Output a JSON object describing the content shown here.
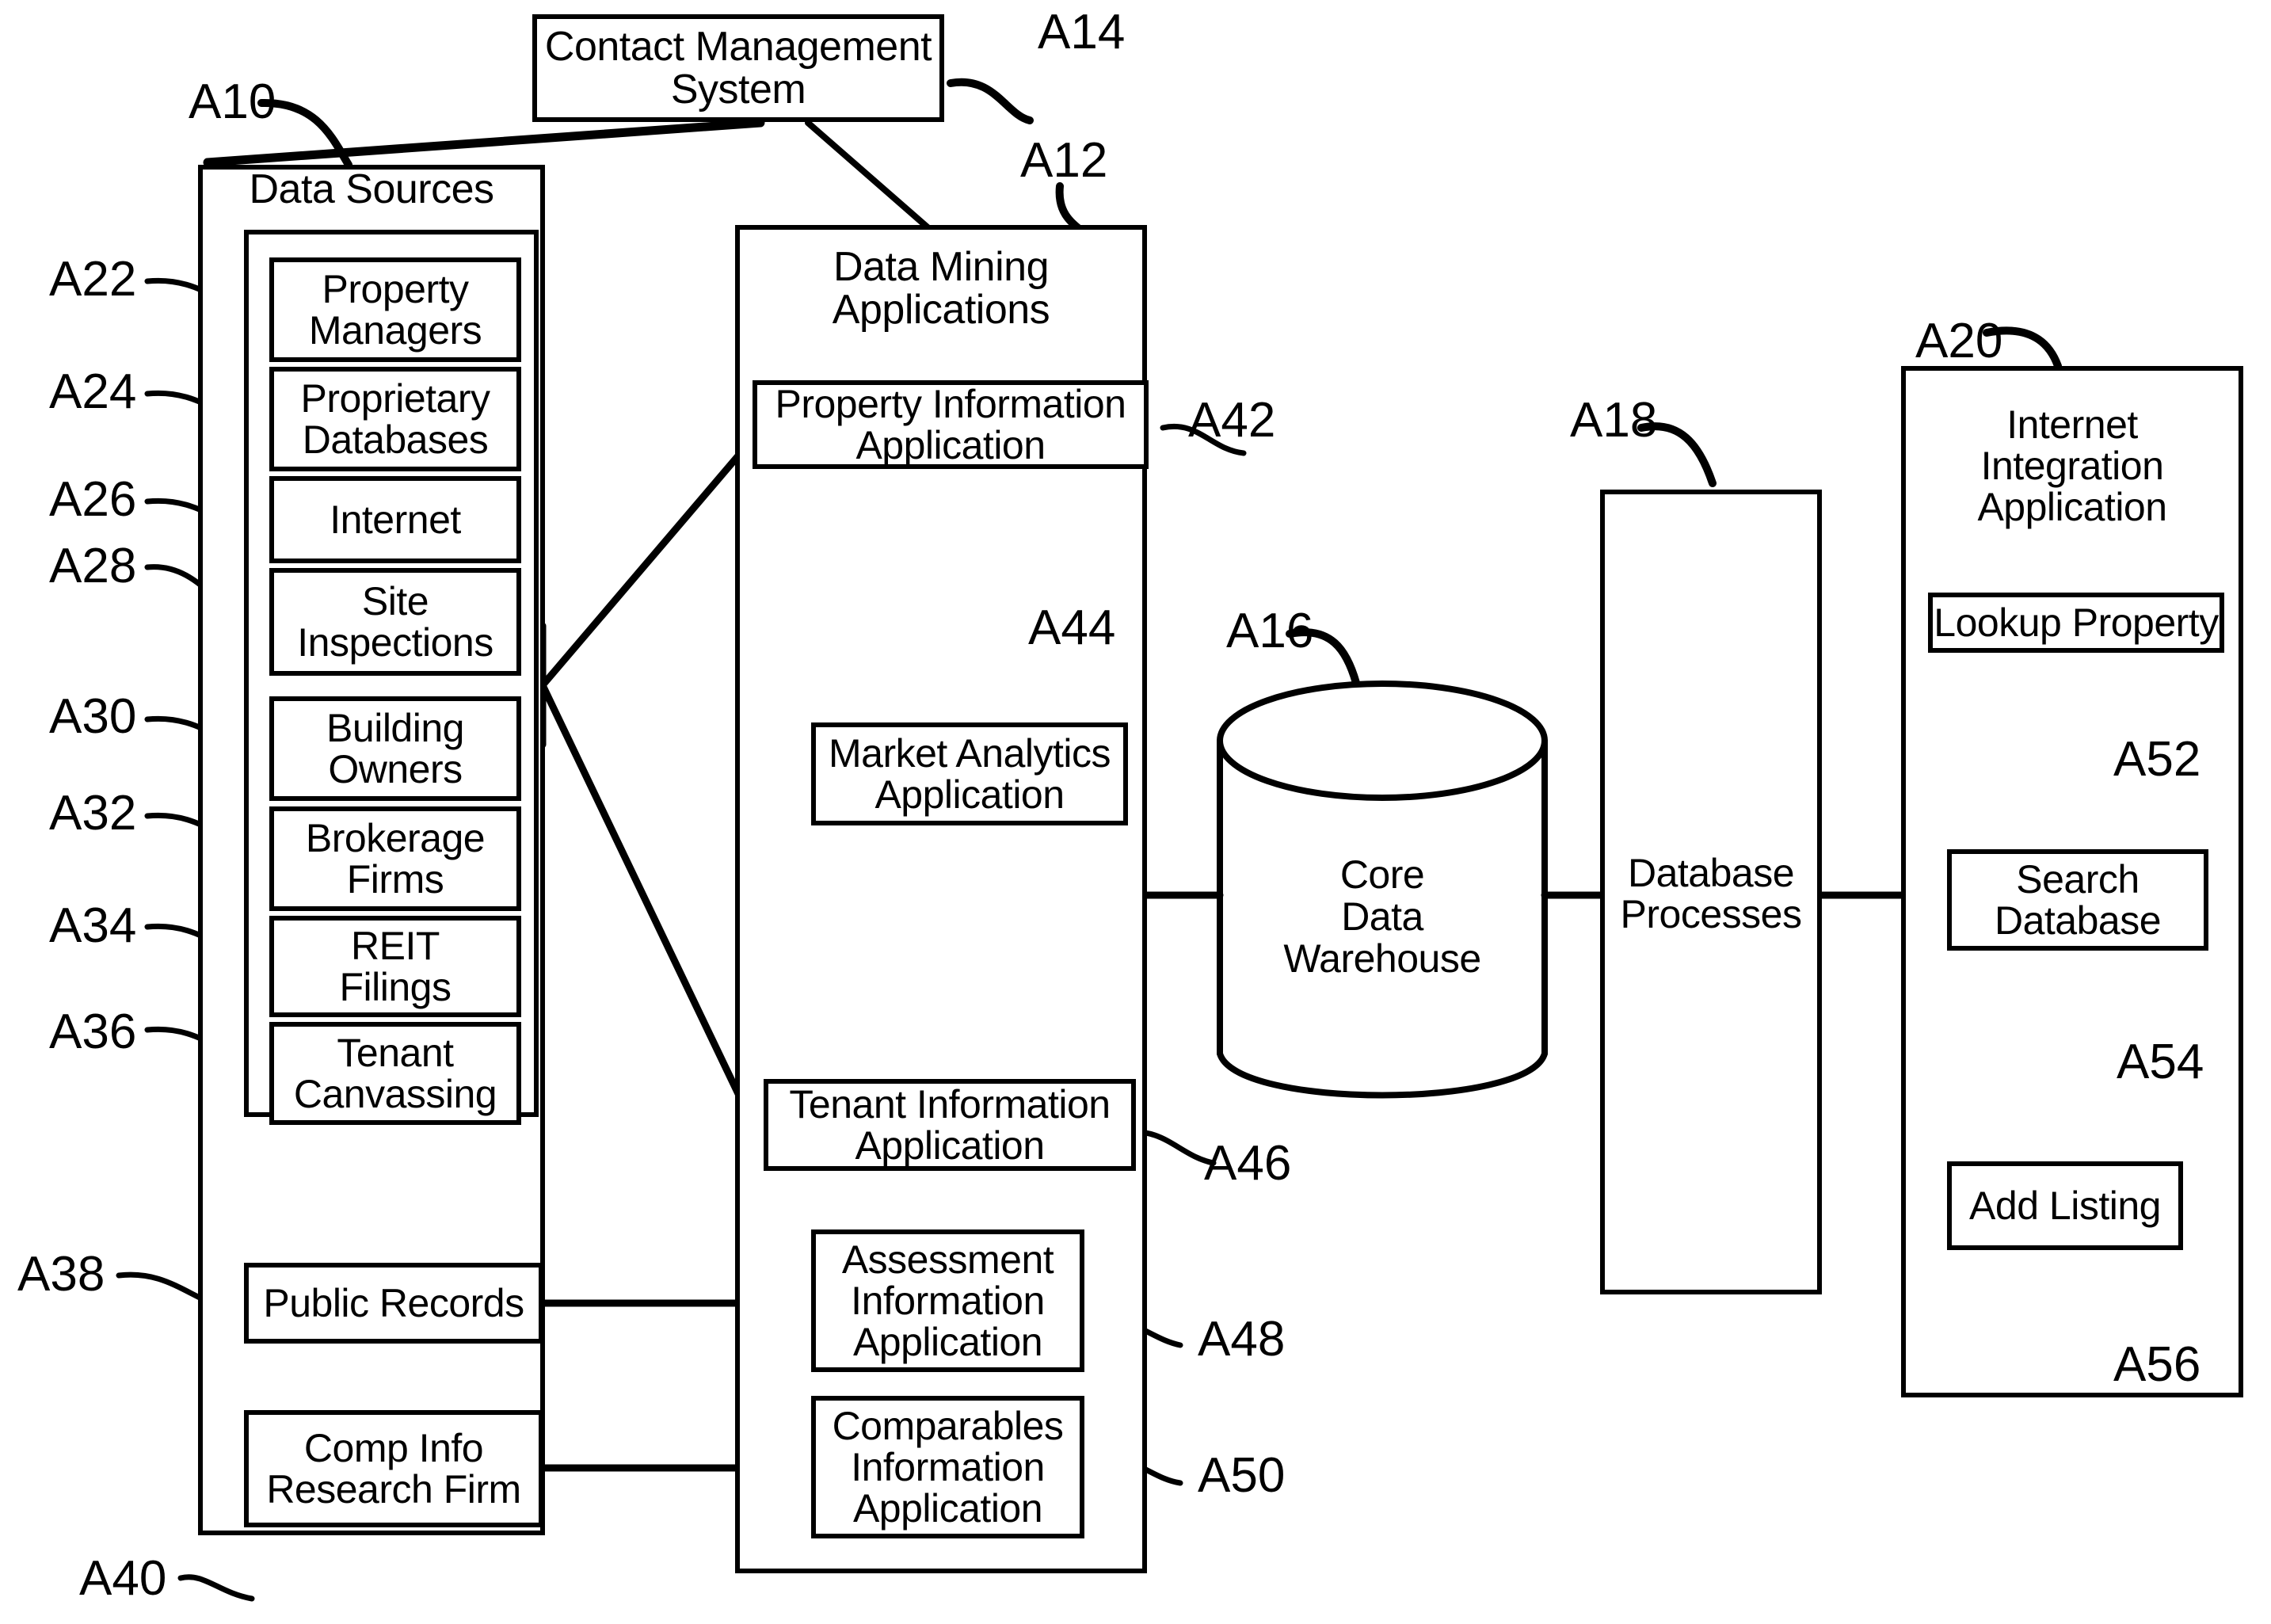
{
  "figure": {
    "title": "Commercial real estate data system block diagram",
    "line_color": "#000000",
    "background": "#ffffff"
  },
  "nodes": {
    "contact_management_system": {
      "label": "Contact Management\nSystem",
      "ref": "A14"
    },
    "data_sources": {
      "label": "Data Sources",
      "ref": "A10"
    },
    "data_mining_applications": {
      "label": "Data Mining\nApplications",
      "ref": "A12"
    },
    "core_data_warehouse": {
      "label": "Core\nData\nWarehouse",
      "ref": "A16"
    },
    "database_processes": {
      "label": "Database\nProcesses",
      "ref": "A18"
    },
    "internet_integration_application": {
      "label": "Internet\nIntegration\nApplication",
      "ref": "A20"
    }
  },
  "data_source_items": [
    {
      "label": "Property\nManagers",
      "ref": "A22"
    },
    {
      "label": "Proprietary\nDatabases",
      "ref": "A24"
    },
    {
      "label": "Internet",
      "ref": "A26"
    },
    {
      "label": "Site\nInspections",
      "ref": "A28"
    },
    {
      "label": "Building\nOwners",
      "ref": "A30"
    },
    {
      "label": "Brokerage\nFirms",
      "ref": "A32"
    },
    {
      "label": "REIT\nFilings",
      "ref": "A34"
    },
    {
      "label": "Tenant\nCanvassing",
      "ref": "A36"
    }
  ],
  "data_source_outer_items": [
    {
      "label": "Public Records",
      "ref": "A38"
    },
    {
      "label": "Comp Info\nResearch Firm",
      "ref": "A40"
    }
  ],
  "data_mining_items": [
    {
      "label": "Property Information\nApplication",
      "ref": "A42"
    },
    {
      "label": "Market Analytics\nApplication",
      "ref": "A44"
    },
    {
      "label": "Tenant Information\nApplication",
      "ref": "A46"
    },
    {
      "label": "Assessment\nInformation\nApplication",
      "ref": "A48"
    },
    {
      "label": "Comparables\nInformation\nApplication",
      "ref": "A50"
    }
  ],
  "internet_integration_items": [
    {
      "label": "Lookup Property",
      "ref": "A52"
    },
    {
      "label": "Search\nDatabase",
      "ref": "A54"
    },
    {
      "label": "Add Listing",
      "ref": "A56"
    }
  ]
}
